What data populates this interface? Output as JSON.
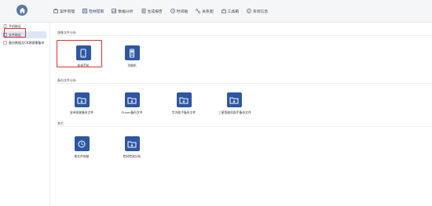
{
  "topbar": {
    "nav": [
      {
        "label": "案件管理",
        "icon": "briefcase-icon"
      },
      {
        "label": "检材提取",
        "icon": "extract-icon"
      },
      {
        "label": "数据分析",
        "icon": "analysis-icon"
      },
      {
        "label": "生成报告",
        "icon": "report-icon"
      },
      {
        "label": "时间轴",
        "icon": "timeline-icon"
      },
      {
        "label": "关系图",
        "icon": "relation-icon"
      },
      {
        "label": "工具箱",
        "icon": "toolbox-icon"
      },
      {
        "label": "系统信息",
        "icon": "info-icon"
      }
    ]
  },
  "sidebar": {
    "items": [
      {
        "label": "手机取证"
      },
      {
        "label": "文件取证"
      },
      {
        "label": "备份数据及CK源镜像备份"
      }
    ]
  },
  "sections": [
    {
      "title": "镜像文件分析",
      "tiles": [
        {
          "label": "安卓手机"
        },
        {
          "label": "功能机"
        }
      ]
    },
    {
      "title": "备份文件分析",
      "tiles": [
        {
          "label": "安卓恢复备份文件"
        },
        {
          "label": "iTunes备份文件"
        },
        {
          "label": "华为助手备份文件"
        },
        {
          "label": "三星智能机助手备份文件"
        }
      ]
    },
    {
      "title": "其它",
      "tiles": [
        {
          "label": "按文件恢复"
        },
        {
          "label": "检材检测分析"
        }
      ]
    }
  ],
  "colors": {
    "accent": "#2d56a3",
    "highlight": "#e03030",
    "sidebar_active": "#dde6f4"
  }
}
